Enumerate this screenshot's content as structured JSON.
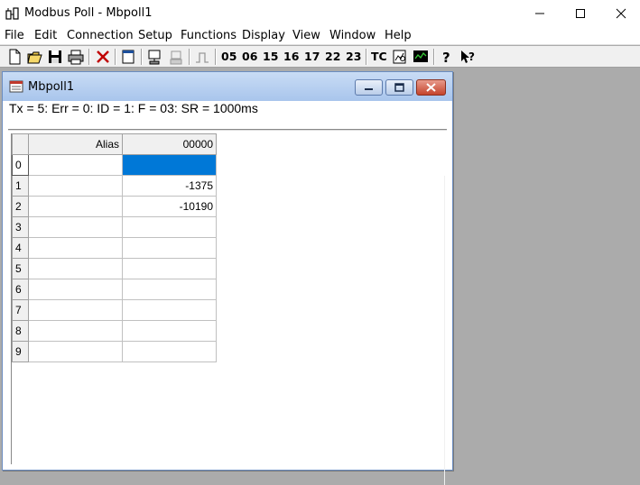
{
  "window": {
    "title": "Modbus Poll - Mbpoll1"
  },
  "menu": [
    "File",
    "Edit",
    "Connection",
    "Setup",
    "Functions",
    "Display",
    "View",
    "Window",
    "Help"
  ],
  "toolbar": {
    "function_codes": [
      "05",
      "06",
      "15",
      "16",
      "17",
      "22",
      "23"
    ],
    "tc_label": "TC"
  },
  "child": {
    "title": "Mbpoll1",
    "status": "Tx = 5: Err = 0: ID = 1: F = 03: SR = 1000ms"
  },
  "grid": {
    "columns": [
      "Alias",
      "00000"
    ],
    "rows": [
      {
        "index": "0",
        "alias": "",
        "value": ""
      },
      {
        "index": "1",
        "alias": "",
        "value": "-1375"
      },
      {
        "index": "2",
        "alias": "",
        "value": "-10190"
      },
      {
        "index": "3",
        "alias": "",
        "value": ""
      },
      {
        "index": "4",
        "alias": "",
        "value": ""
      },
      {
        "index": "5",
        "alias": "",
        "value": ""
      },
      {
        "index": "6",
        "alias": "",
        "value": ""
      },
      {
        "index": "7",
        "alias": "",
        "value": ""
      },
      {
        "index": "8",
        "alias": "",
        "value": ""
      },
      {
        "index": "9",
        "alias": "",
        "value": ""
      }
    ]
  },
  "colors": {
    "selection": "#0078d7",
    "desktop": "#ababab"
  }
}
